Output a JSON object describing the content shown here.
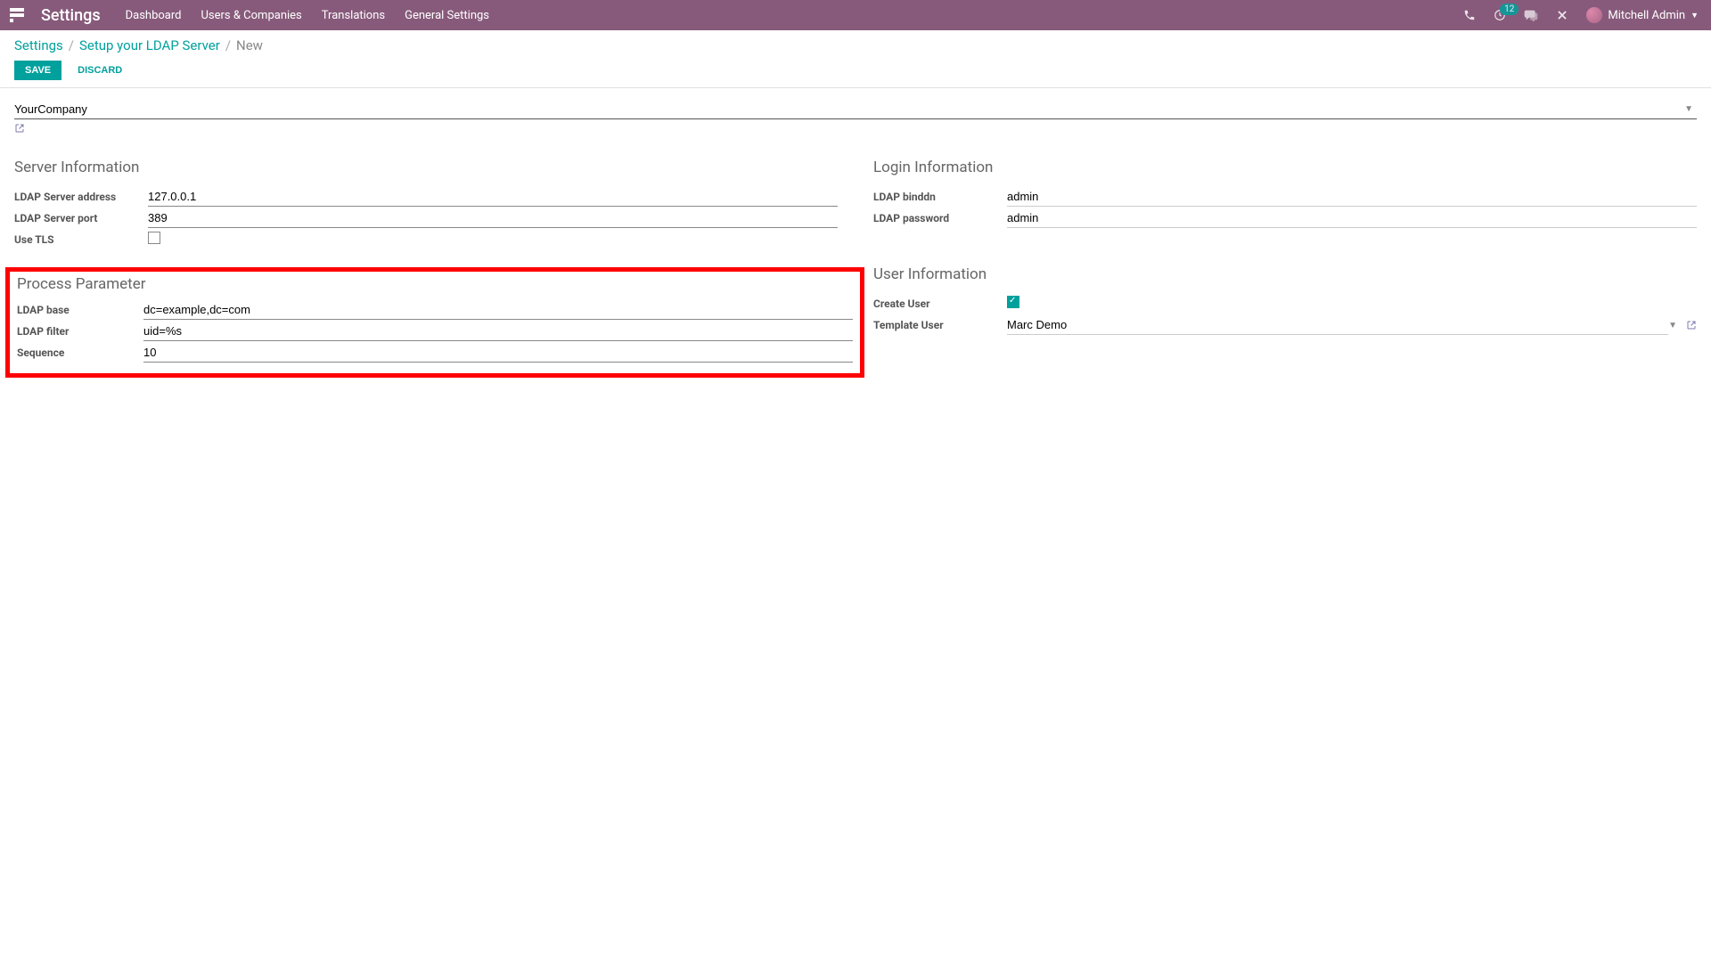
{
  "topbar": {
    "brand": "Settings",
    "menu": [
      "Dashboard",
      "Users & Companies",
      "Translations",
      "General Settings"
    ],
    "activity_count": "12",
    "user": "Mitchell Admin"
  },
  "breadcrumb": {
    "root": "Settings",
    "parent": "Setup your LDAP Server",
    "current": "New"
  },
  "actions": {
    "save": "SAVE",
    "discard": "DISCARD"
  },
  "company": {
    "value": "YourCompany"
  },
  "server_info": {
    "title": "Server Information",
    "address_label": "LDAP Server address",
    "address": "127.0.0.1",
    "port_label": "LDAP Server port",
    "port": "389",
    "tls_label": "Use TLS"
  },
  "login_info": {
    "title": "Login Information",
    "binddn_label": "LDAP binddn",
    "binddn": "admin",
    "password_label": "LDAP password",
    "password": "admin"
  },
  "process": {
    "title": "Process Parameter",
    "base_label": "LDAP base",
    "base": "dc=example,dc=com",
    "filter_label": "LDAP filter",
    "filter": "uid=%s",
    "sequence_label": "Sequence",
    "sequence": "10"
  },
  "user_info": {
    "title": "User Information",
    "create_label": "Create User",
    "template_label": "Template User",
    "template": "Marc Demo"
  }
}
